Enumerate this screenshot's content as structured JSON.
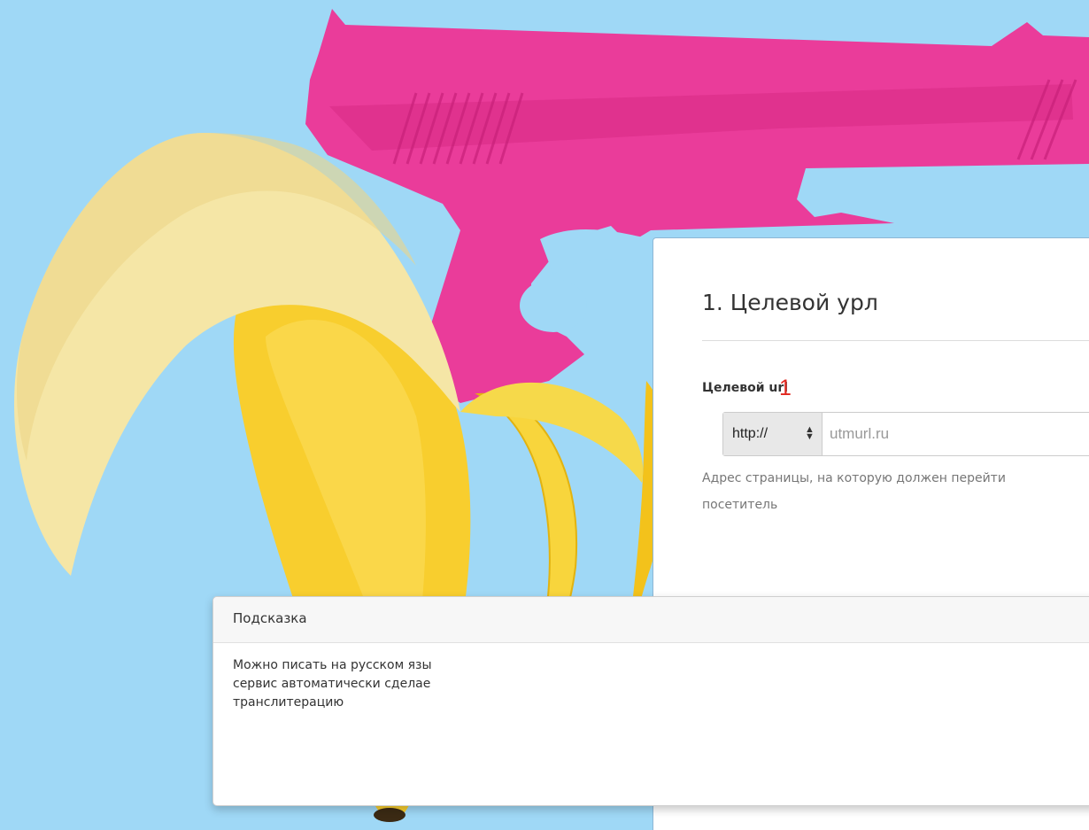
{
  "background": {
    "color": "#9fd8f6",
    "artwork": "pink-gun-in-peeled-banana"
  },
  "form": {
    "section_title": "1. Целевой урл",
    "field_label": "Целевой url",
    "annotation_number": "1",
    "protocol_select": {
      "value": "http://",
      "icon": "select-arrows-icon"
    },
    "url_input": {
      "value": "",
      "placeholder": "utmurl.ru"
    },
    "help_text": {
      "line1": "Адрес страницы, на которую должен перейти",
      "line2": "посетитель"
    }
  },
  "hint": {
    "title": "Подсказка",
    "line1": "Можно писать на русском язы",
    "line2": "сервис автоматически сделае",
    "line3": "транслитерацию"
  },
  "colors": {
    "annotation": "#e2261e",
    "panel_border": "#8db7d5",
    "gun": "#ea3c9a",
    "banana": "#f8ce2e",
    "banana_peel": "#f5e6a6"
  }
}
